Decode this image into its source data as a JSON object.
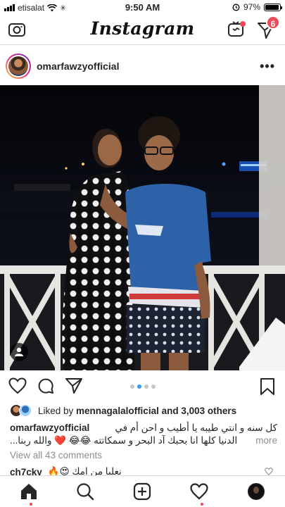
{
  "status_bar": {
    "carrier": "etisalat",
    "time": "9:50 AM",
    "battery_text": "97%",
    "battery_level": 0.97
  },
  "header": {
    "logo_text": "Instagram",
    "dm_badge_count": "6",
    "icons": [
      "camera-icon",
      "igtv-icon",
      "direct-message-icon"
    ]
  },
  "post": {
    "username": "omarfawzyofficial",
    "carousel": {
      "count": 4,
      "active_index": 1
    },
    "likes": {
      "prefix": "Liked by ",
      "liker": "mennagalalofficial",
      "suffix": " and 3,003 others"
    },
    "caption": {
      "username": "omarfawzyofficial",
      "line1": "كل سنه و انتي طيبه يا أطيب و احن أم في",
      "line2": "الدنيا كلها انا بحبك آد البحر و سمكاتته 😂😂 ❤️ والله ربنا...",
      "more_label": "more"
    },
    "view_all_comments": "View all 43 comments",
    "comment": {
      "username": "ch7cky",
      "text": "نعلبا من امك 😍🔥"
    }
  },
  "tabbar": {
    "items": [
      "home-icon",
      "search-icon",
      "new-post-icon",
      "activity-icon",
      "profile-icon"
    ]
  },
  "colors": {
    "accent_blue": "#3897f0",
    "badge_red": "#ed4956",
    "text_dark": "#262626",
    "text_muted": "#8e8e8e"
  }
}
